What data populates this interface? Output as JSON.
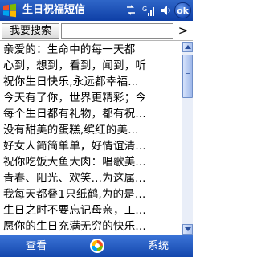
{
  "titlebar": {
    "title": "生日祝福短信",
    "ok_label": "ok"
  },
  "search": {
    "button_label": "我要搜索",
    "input_value": "",
    "go_label": ">"
  },
  "messages": [
    "亲爱的：生命中的每一天都",
    "心到，想到，看到，闻到，听",
    "祝你生日快乐,永远都幸福...",
    "今天有了你，世界更精彩；今",
    "每个生日都有礼物，都有祝...",
    "没有甜美的蛋糕,缤红的美...",
    "好女人简简单单，好情谊清...",
    "祝你吃饭大鱼大肉：唱歌美...",
    "青春、阳光、欢笑...为这属...",
    "我每天都叠1只纸鹤,为的是...",
    "生日之时不要忘记母亲，工...",
    "愿你的生日充满无穷的快乐..."
  ],
  "menubar": {
    "left_label": "查看",
    "right_label": "系统"
  },
  "colors": {
    "titlebar": "#1d4fb3",
    "menubar": "#1d57c0"
  }
}
